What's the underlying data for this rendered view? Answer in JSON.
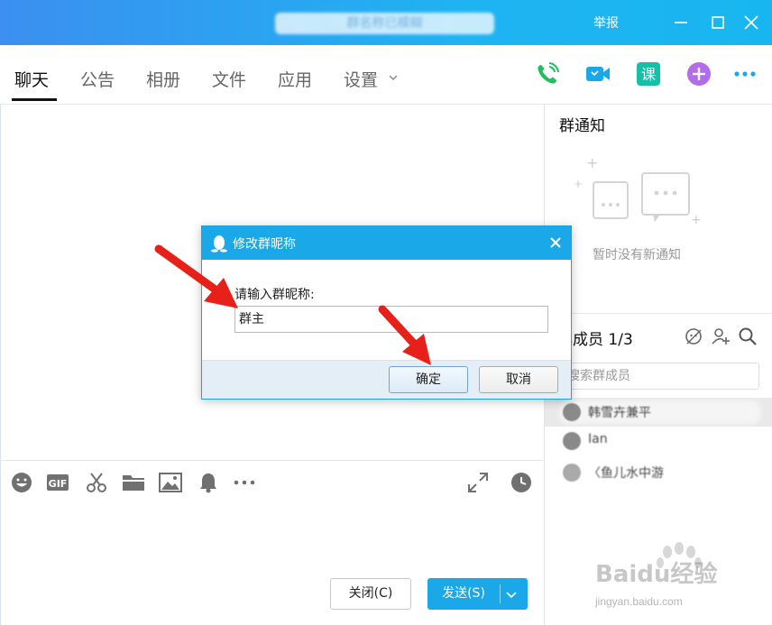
{
  "window": {
    "title": "群名称已模糊",
    "report_label": "举报"
  },
  "tabs": [
    {
      "label": "聊天",
      "active": true
    },
    {
      "label": "公告",
      "active": false
    },
    {
      "label": "相册",
      "active": false
    },
    {
      "label": "文件",
      "active": false
    },
    {
      "label": "应用",
      "active": false
    },
    {
      "label": "设置",
      "active": false
    }
  ],
  "top_icons": [
    "phone-icon",
    "video-icon",
    "class-icon",
    "add-app-icon",
    "more-icon"
  ],
  "toolbar_icons": [
    "emoji-icon",
    "gif-icon",
    "scissors-icon",
    "folder-icon",
    "image-icon",
    "bell-icon",
    "more-icon",
    "expand-icon",
    "history-icon"
  ],
  "input_area": {
    "close_label": "关闭(C)",
    "send_label": "发送(S)"
  },
  "notice": {
    "title": "群通知",
    "empty_text": "暂时没有新通知"
  },
  "members": {
    "title": "群成员 1/3",
    "search_placeholder": "搜索群成员",
    "list": [
      {
        "name": "韩雪卉兼平",
        "selected": true
      },
      {
        "name": "Ian",
        "selected": false
      },
      {
        "name": "〈鱼儿水中游",
        "selected": false
      }
    ]
  },
  "dialog": {
    "title": "修改群昵称",
    "label": "请输入群昵称:",
    "input_value": "群主",
    "ok_label": "确定",
    "cancel_label": "取消"
  },
  "watermark": {
    "brand": "Baidu经验",
    "url": "jingyan.baidu.com"
  },
  "colors": {
    "accent": "#1aa8e8",
    "arrow_red": "#e8201a"
  }
}
